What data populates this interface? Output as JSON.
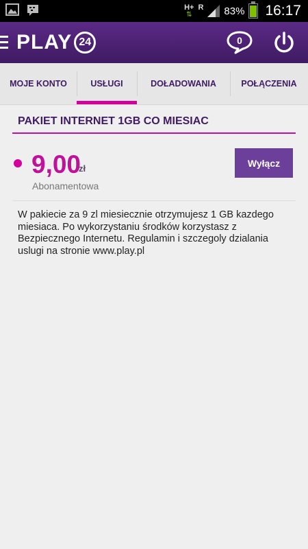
{
  "status_bar": {
    "network_type": "H+",
    "roaming_indicator": "R",
    "battery_percent": "83%",
    "time": "16:17",
    "left_icons": [
      "image-notification-icon",
      "bbm-notification-icon"
    ]
  },
  "header": {
    "logo_text": "PLAY",
    "logo_badge": "24",
    "chat_count": "0"
  },
  "tabs": [
    {
      "label": "MOJE KONTO",
      "active": false
    },
    {
      "label": "USŁUGI",
      "active": true
    },
    {
      "label": "DOŁADOWANIA",
      "active": false
    },
    {
      "label": "POŁĄCZENIA",
      "active": false
    }
  ],
  "service": {
    "title": "PAKIET INTERNET 1GB CO MIESIAC",
    "price": "9,00",
    "currency": "zł",
    "price_type": "Abonamentowa",
    "disable_label": "Wyłącz",
    "description": "W pakiecie za 9 zl miesiecznie otrzymujesz 1 GB kazdego miesiaca. Po wykorzystaniu środków korzystasz z Bezpiecznego Internetu. Regulamin i szczegoly dzialania uslugi na stronie www.play.pl"
  },
  "colors": {
    "brand_purple": "#4a2070",
    "accent_magenta": "#d4009b",
    "button_purple": "#6b3f9a"
  }
}
